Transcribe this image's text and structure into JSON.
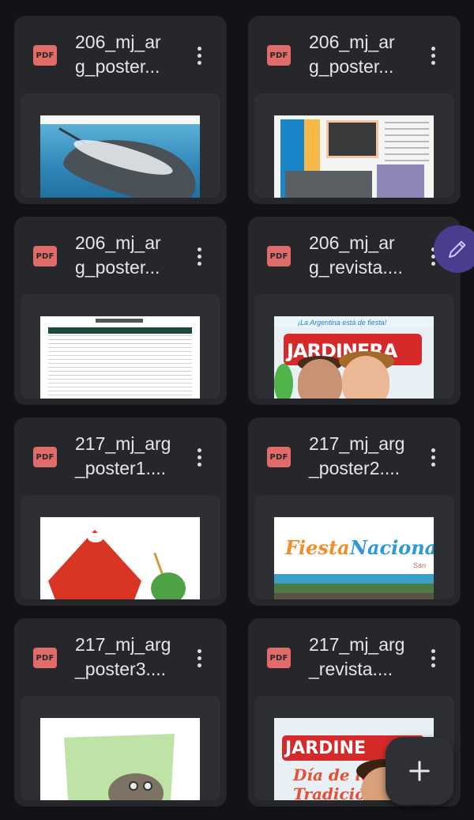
{
  "files": [
    {
      "name": "206_mj_ar\ng_poster...",
      "type": "PDF",
      "thumb": "stingray"
    },
    {
      "name": "206_mj_ar\ng_poster...",
      "type": "PDF",
      "thumb": "bird-infographic"
    },
    {
      "name": "206_mj_ar\ng_poster...",
      "type": "PDF",
      "thumb": "materials-list"
    },
    {
      "name": "206_mj_ar\ng_revista....",
      "type": "PDF",
      "thumb": "magazine-cover"
    },
    {
      "name": "217_mj_arg\n_poster1....",
      "type": "PDF",
      "thumb": "poncho-mate"
    },
    {
      "name": "217_mj_arg\n_poster2....",
      "type": "PDF",
      "thumb": "fiesta-nacional"
    },
    {
      "name": "217_mj_arg\n_poster3....",
      "type": "PDF",
      "thumb": "clay-figure"
    },
    {
      "name": "217_mj_arg\n_revista....",
      "type": "PDF",
      "thumb": "magazine-cover-2"
    }
  ],
  "thumb_text": {
    "magazine_top": "¡La Argentina está de fiesta!",
    "magazine_logo": "JARDINERA",
    "magazine2_logo": "JARDINE",
    "magazine2_sub": "Día de la Tradición",
    "fiesta_word1": "Fiesta",
    "fiesta_word2": "Naciona",
    "fiesta_small": "San"
  },
  "fab": {
    "edit_icon": "pencil-icon",
    "add_icon": "plus-icon",
    "edit_color": "#4a3d8f"
  },
  "colors": {
    "background": "#121316",
    "card": "#26272b",
    "pdf_badge": "#e16b68"
  }
}
